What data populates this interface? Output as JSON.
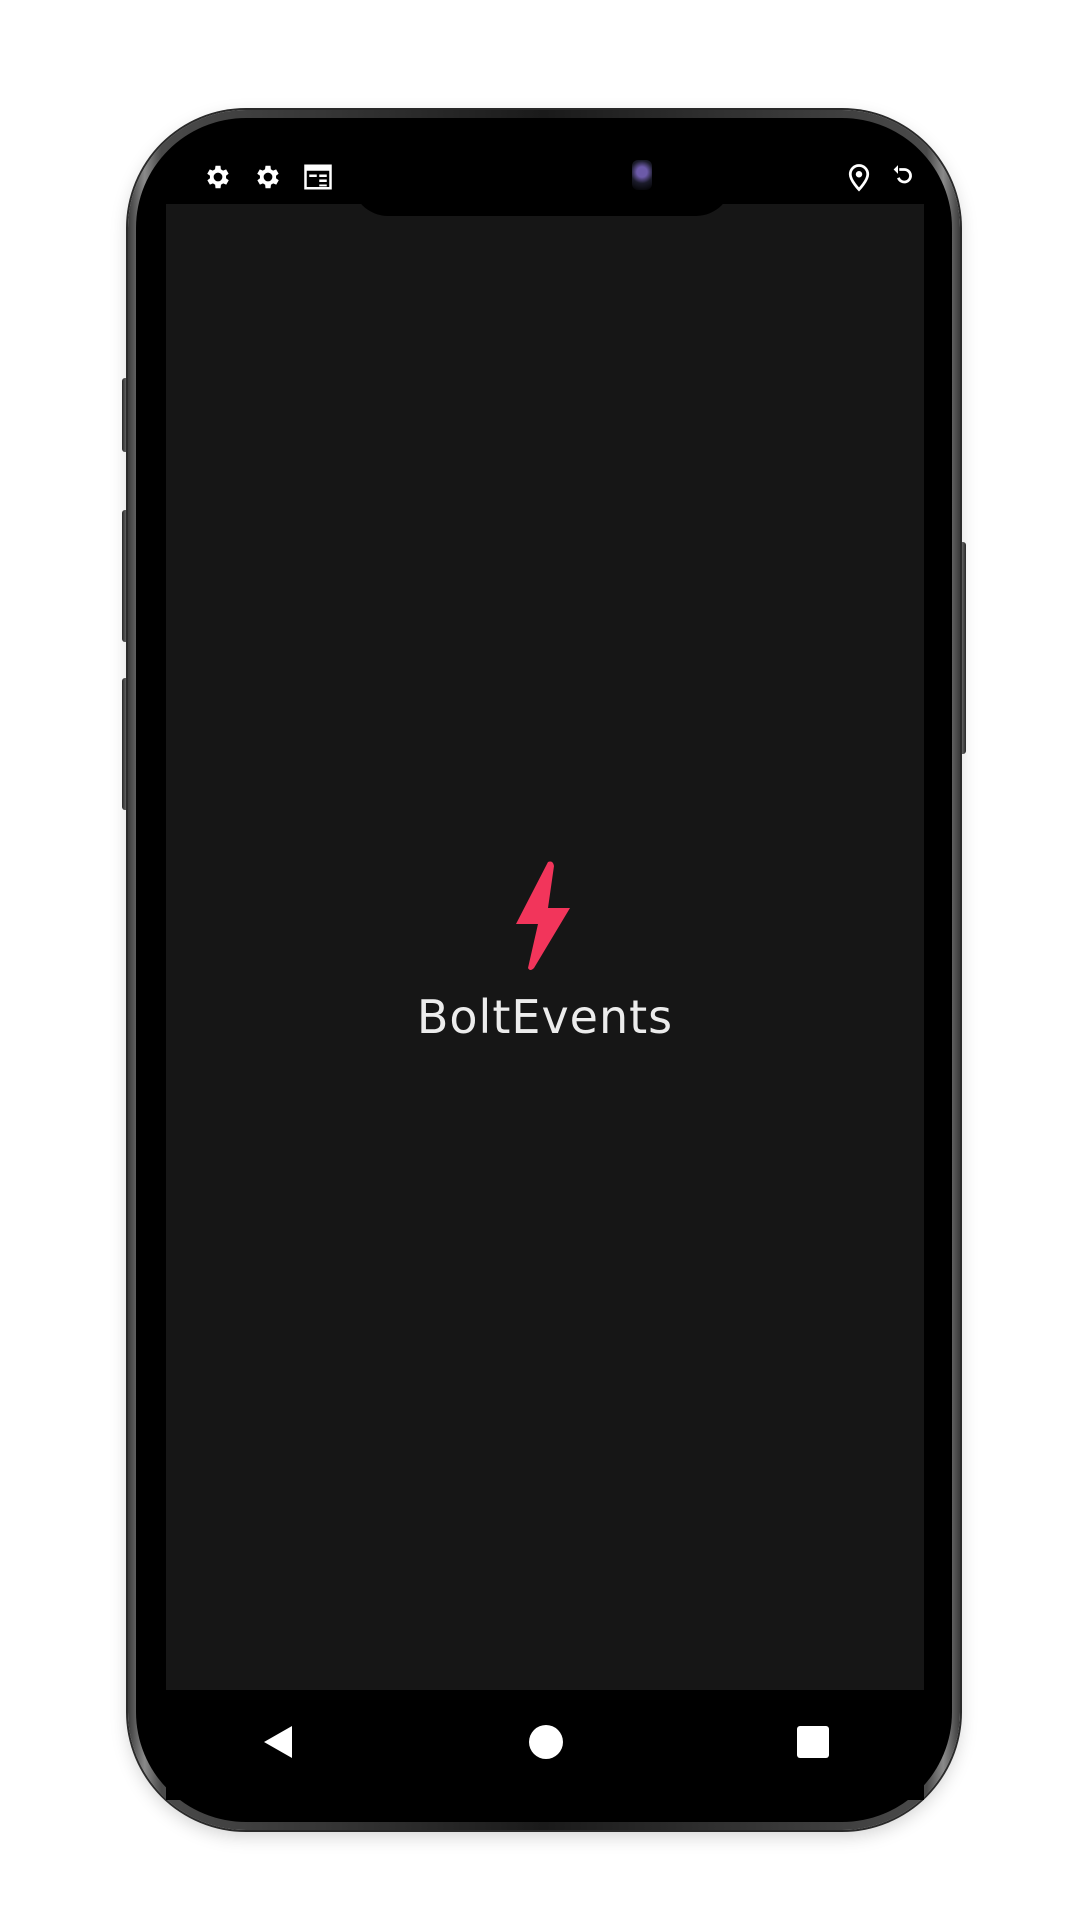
{
  "status_bar": {
    "left_icons": [
      "gear-icon",
      "gear-icon",
      "calendar-icon"
    ],
    "right_icons": [
      "location-pin-icon",
      "rotate-icon"
    ]
  },
  "splash": {
    "app_name": "BoltEvents",
    "logo_icon": "lightning-bolt-icon",
    "accent_color": "#F2355B",
    "background_color": "#161616",
    "title_color": "#ECECEC"
  },
  "nav_bar": {
    "buttons": [
      "back-icon",
      "home-icon",
      "recents-icon"
    ]
  }
}
